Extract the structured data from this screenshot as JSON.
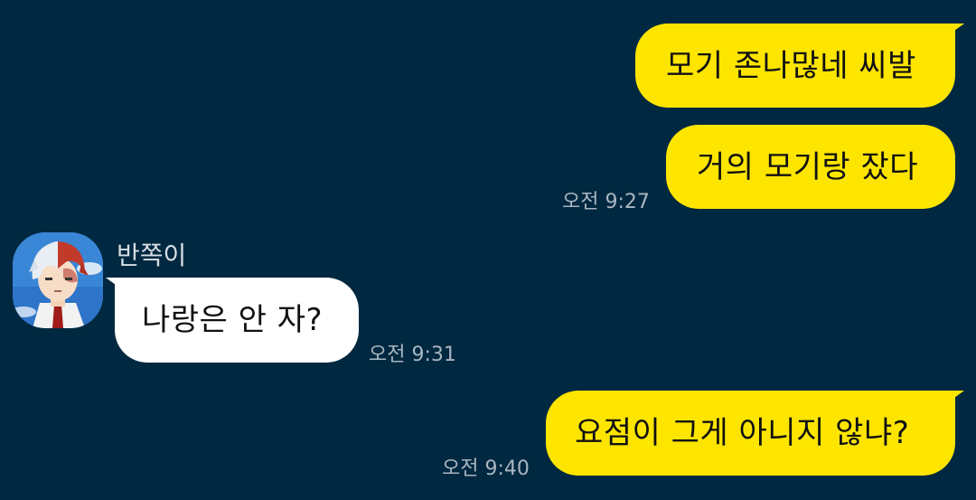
{
  "conversation": {
    "messages": [
      {
        "direction": "outgoing",
        "text": "모기 존나많네 씨발",
        "time": ""
      },
      {
        "direction": "outgoing",
        "text": "거의 모기랑 잤다",
        "time": "오전 9:27"
      },
      {
        "direction": "incoming",
        "sender": "반쪽이",
        "text": "나랑은 안 자?",
        "time": "오전 9:31"
      },
      {
        "direction": "outgoing",
        "text": "요점이 그게 아니지 않냐?",
        "time": "오전 9:40"
      }
    ]
  },
  "colors": {
    "background": "#002840",
    "outgoing_bubble": "#FEE500",
    "incoming_bubble": "#FFFFFF",
    "timestamp": "#A9B6C1"
  },
  "icons": {
    "avatar": "anime-character-avatar"
  }
}
